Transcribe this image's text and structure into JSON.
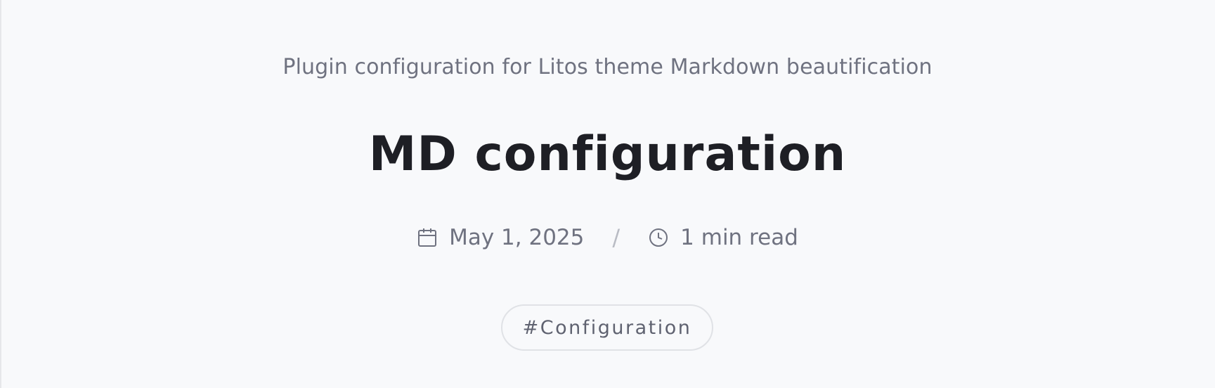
{
  "post": {
    "description": "Plugin configuration for Litos theme Markdown beautification",
    "title": "MD configuration",
    "date": "May 1, 2025",
    "separator": "/",
    "reading_time": "1 min read",
    "tag": "#Configuration"
  },
  "icons": {
    "date": "calendar-icon",
    "reading_time": "clock-icon"
  },
  "colors": {
    "background": "#f8f9fb",
    "title": "#1e1f25",
    "muted_text": "#6f7280",
    "tag_border": "#e0e2e6"
  }
}
